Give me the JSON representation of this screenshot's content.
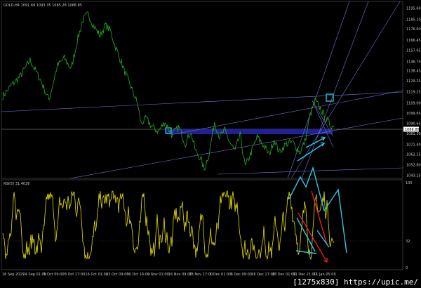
{
  "main": {
    "header": "GOLD,H4 1091.69 1093.35 1085.28 1086.85",
    "current_price": "1086.85",
    "price_ticks": [
      "1195.60",
      "1185.10",
      "1176.60",
      "1166.45",
      "1157.05",
      "1146.70",
      "1138.45",
      "1129.25",
      "1119.25",
      "1109.00",
      "1099.65",
      "1090.65",
      "1081.30",
      "1071.40",
      "1062.25",
      "1052.80",
      "1043.25"
    ],
    "y_min": 1039,
    "y_max": 1199
  },
  "indicator": {
    "header": "RSI(5) 31.4026",
    "ticks": [
      "100",
      "32",
      "0"
    ],
    "y_min": 0,
    "y_max": 100
  },
  "time_axis": [
    "16 Sep 2015",
    "24 Sep 01:00",
    "5 Oct 09:00",
    "8 Oct 17:00",
    "16 Oct 01:00",
    "23 Oct 09:00",
    "30 Oct 16:00",
    "9 Nov 01:00",
    "16 Nov 09:00",
    "23 Nov 17:00",
    "1 Dec 01:00",
    "8 Dec 09:00",
    "16 Dec 17:00",
    "23 Dec 01:00",
    "31 Dec 21:00",
    "11 Jan 05:00"
  ],
  "watermark": "[1275x830] https://upic.me/",
  "colors": {
    "background": "#000000",
    "price_line": "#1fb11f",
    "rsi_line": "#e8e000",
    "trendline": "#6f78d9",
    "zone": "#2222aa",
    "cyan": "#30c8e8",
    "red": "#e02020",
    "grid_text": "#c8c8c8"
  },
  "chart_data": [
    {
      "type": "line",
      "title": "GOLD,H4 1091.69 1093.35 1085.28 1086.85",
      "ylim": [
        1039,
        1199
      ],
      "x": [
        "16 Sep 2015",
        "24 Sep 01:00",
        "5 Oct 09:00",
        "8 Oct 17:00",
        "16 Oct 01:00",
        "23 Oct 09:00",
        "30 Oct 16:00",
        "9 Nov 01:00",
        "16 Nov 09:00",
        "23 Nov 17:00",
        "1 Dec 01:00",
        "8 Dec 09:00",
        "16 Dec 17:00",
        "23 Dec 01:00",
        "31 Dec 21:00",
        "11 Jan 05:00"
      ],
      "anchors": [
        [
          0,
          1115
        ],
        [
          0.5,
          1125
        ],
        [
          1,
          1133
        ],
        [
          1.6,
          1148
        ],
        [
          2.2,
          1130
        ],
        [
          2.7,
          1112
        ],
        [
          3.2,
          1143
        ],
        [
          3.6,
          1150
        ],
        [
          4.0,
          1140
        ],
        [
          4.4,
          1168
        ],
        [
          4.7,
          1185
        ],
        [
          5.0,
          1190
        ],
        [
          5.3,
          1180
        ],
        [
          5.7,
          1170
        ],
        [
          6.0,
          1180
        ],
        [
          6.3,
          1175
        ],
        [
          6.6,
          1160
        ],
        [
          6.9,
          1148
        ],
        [
          7.2,
          1135
        ],
        [
          7.6,
          1120
        ],
        [
          7.9,
          1108
        ],
        [
          8.1,
          1090
        ],
        [
          8.4,
          1095
        ],
        [
          8.7,
          1088
        ],
        [
          9.1,
          1083
        ],
        [
          9.5,
          1092
        ],
        [
          9.9,
          1080
        ],
        [
          10.3,
          1087
        ],
        [
          10.7,
          1072
        ],
        [
          11.0,
          1083
        ],
        [
          11.3,
          1065
        ],
        [
          11.6,
          1058
        ],
        [
          11.8,
          1048
        ],
        [
          12.1,
          1064
        ],
        [
          12.4,
          1092
        ],
        [
          12.7,
          1078
        ],
        [
          13.0,
          1084
        ],
        [
          13.3,
          1073
        ],
        [
          13.6,
          1065
        ],
        [
          13.9,
          1080
        ],
        [
          14.2,
          1051
        ],
        [
          14.6,
          1066
        ],
        [
          14.9,
          1078
        ],
        [
          15.3,
          1070
        ],
        [
          15.6,
          1062
        ],
        [
          15.9,
          1076
        ],
        [
          16.2,
          1064
        ],
        [
          16.6,
          1072
        ],
        [
          17.0,
          1073
        ],
        [
          17.4,
          1064
        ],
        [
          17.7,
          1074
        ],
        [
          18.0,
          1098
        ],
        [
          18.3,
          1111
        ],
        [
          18.6,
          1104
        ],
        [
          18.9,
          1095
        ],
        [
          19.2,
          1089
        ],
        [
          19.4,
          1087
        ]
      ]
    },
    {
      "type": "line",
      "title": "RSI(5) 31.4026",
      "ylim": [
        0,
        100
      ],
      "anchors": "oscillating roughly between 15 and 90 from 16 Sep 2015 to 11 Jan 05:00, last value 31.4026"
    }
  ]
}
